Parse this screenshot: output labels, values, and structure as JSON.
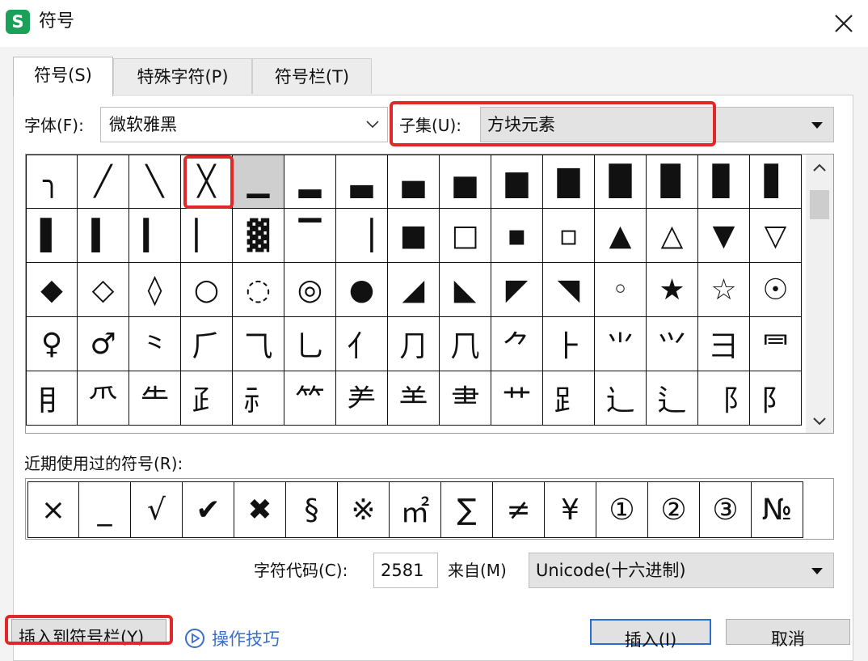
{
  "window": {
    "title": "符号",
    "app_icon_letter": "S"
  },
  "tabs": [
    {
      "label": "符号(S)",
      "active": true
    },
    {
      "label": "特殊字符(P)",
      "active": false
    },
    {
      "label": "符号栏(T)",
      "active": false
    }
  ],
  "font": {
    "label": "字体(F):",
    "value": "微软雅黑"
  },
  "subset": {
    "label": "子集(U):",
    "value": "方块元素"
  },
  "symbol_grid": {
    "rows": [
      [
        "╮",
        "╱",
        "╲",
        "╳",
        "▁",
        "▂",
        "▃",
        "▄",
        "▅",
        "▆",
        "▇",
        "█",
        "▉",
        "▊",
        "▋"
      ],
      [
        "▌",
        "▍",
        "▎",
        "▏",
        "▓",
        "▔",
        "▕",
        "■",
        "□",
        "▪",
        "▫",
        "▲",
        "△",
        "▼",
        "▽"
      ],
      [
        "◆",
        "◇",
        "◊",
        "○",
        "◌",
        "◎",
        "●",
        "◢",
        "◣",
        "◤",
        "◥",
        "◦",
        "★",
        "☆",
        "☉"
      ],
      [
        "♀",
        "♂",
        "⺀",
        "⺁",
        "⺄",
        "⺃",
        "⺅",
        "⺆",
        "⺇",
        "⺈",
        "⺊",
        "⺌",
        "⺍",
        "⺕",
        "⺜"
      ],
      [
        "⺝",
        "⺥",
        "⺧",
        "⺪",
        "⺬",
        "⺮",
        "⺶",
        "⺷",
        "⺻",
        "⺾",
        "⻊",
        "⻌",
        "⻍",
        "⻏",
        "⻖"
      ]
    ],
    "selected": [
      0,
      4
    ]
  },
  "recent": {
    "label": "近期使用过的符号(R):",
    "symbols": [
      "×",
      "_",
      "√",
      "✔",
      "✖",
      "§",
      "※",
      "㎡",
      "∑",
      "≠",
      "¥",
      "①",
      "②",
      "③",
      "№"
    ]
  },
  "char_code": {
    "label": "字符代码(C):",
    "value": "2581"
  },
  "from": {
    "label": "来自(M)",
    "value": "Unicode(十六进制)"
  },
  "buttons": {
    "insert_to_bar": "插入到符号栏(Y)",
    "tips": "操作技巧",
    "insert": "插入(I)",
    "cancel": "取消"
  },
  "colors": {
    "highlight": "#e02828",
    "tips_link": "#3a6fc7",
    "app_icon": "#1ba05a"
  }
}
